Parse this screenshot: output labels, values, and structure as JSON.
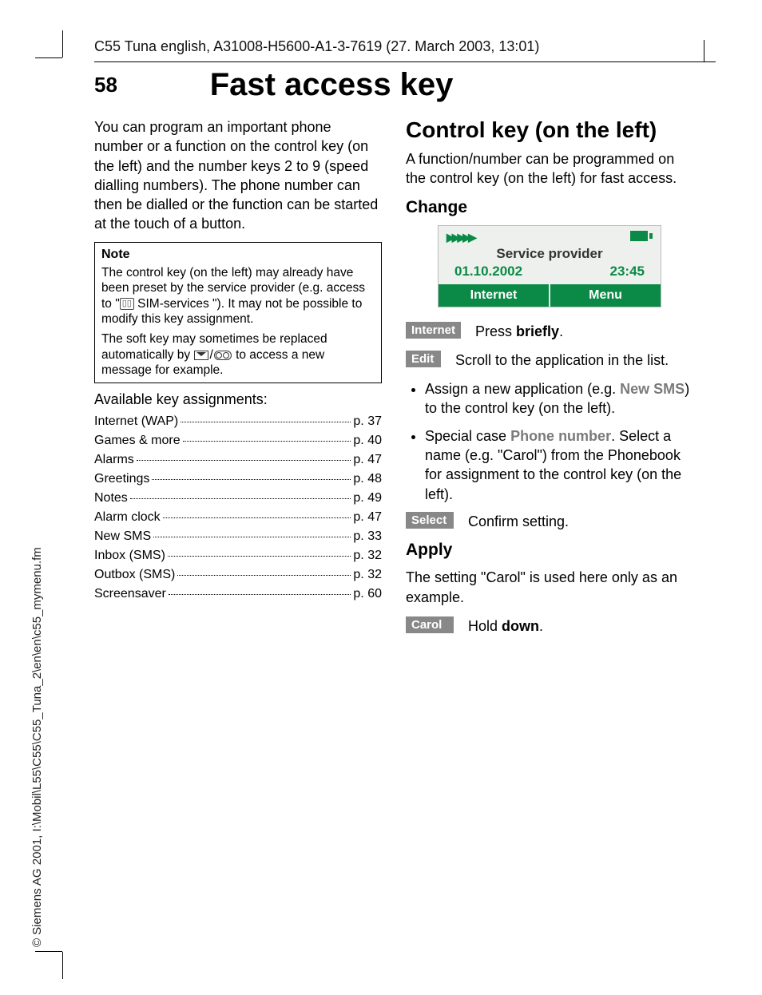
{
  "doc_header": "C55 Tuna english, A31008-H5600-A1-3-7619 (27. March 2003, 13:01)",
  "copyright": "© Siemens AG 2001, I:\\Mobil\\L55\\C55\\C55_Tuna_2\\en\\en\\c55_mymenu.fm",
  "page_number": "58",
  "page_title": "Fast access key",
  "intro": "You can program an important phone number or a function on the control key (on the left) and the number keys 2 to 9 (speed dialling numbers). The phone number can then be dialled or the function can be started at the touch of a button.",
  "note": {
    "title": "Note",
    "p1a": "The control key (on the left) may already have been preset by the service provider (e.g. access to \"",
    "p1b": " SIM-services \"). It may not be possible to modify this key assignment.",
    "p2a": "The soft key may sometimes be replaced automatically by ",
    "p2b": " to access a new message for example."
  },
  "avail_heading": "Available key assignments:",
  "toc": [
    {
      "label": "Internet (WAP)",
      "page": "p. 37"
    },
    {
      "label": "Games & more",
      "page": "p. 40"
    },
    {
      "label": "Alarms",
      "page": "p. 47"
    },
    {
      "label": "Greetings",
      "page": "p. 48"
    },
    {
      "label": "Notes",
      "page": "p. 49"
    },
    {
      "label": "Alarm clock",
      "page": "p. 47"
    },
    {
      "label": "New SMS",
      "page": "p. 33"
    },
    {
      "label": "Inbox (SMS)",
      "page": "p. 32"
    },
    {
      "label": "Outbox (SMS)",
      "page": "p. 32"
    },
    {
      "label": "Screensaver",
      "page": "p. 60"
    }
  ],
  "right": {
    "section_title": "Control key (on the left)",
    "section_text": "A function/number can be programmed on the control key (on the left) for fast access.",
    "change_heading": "Change",
    "screen": {
      "provider": "Service provider",
      "date": "01.10.2002",
      "time": "23:45",
      "soft_left": "Internet",
      "soft_right": "Menu"
    },
    "cmd1": {
      "tag": "Internet",
      "desc_a": "Press ",
      "desc_b": "briefly",
      "desc_c": "."
    },
    "cmd2": {
      "tag": "Edit",
      "desc": "Scroll to the application in the list."
    },
    "bullet1_a": "Assign a new application (e.g. ",
    "bullet1_app": "New SMS",
    "bullet1_b": ") to the control key (on the left).",
    "bullet2_a": "Special case ",
    "bullet2_pn": "Phone number",
    "bullet2_b": ". Select a name (e.g. \"Carol\") from the Phonebook for assignment to  the control key (on the left).",
    "cmd3": {
      "tag": "Select",
      "desc": "Confirm setting."
    },
    "apply_heading": "Apply",
    "apply_text": "The setting \"Carol\" is used here only as an example.",
    "cmd4": {
      "tag": "Carol",
      "desc_a": "Hold ",
      "desc_b": "down",
      "desc_c": "."
    }
  }
}
